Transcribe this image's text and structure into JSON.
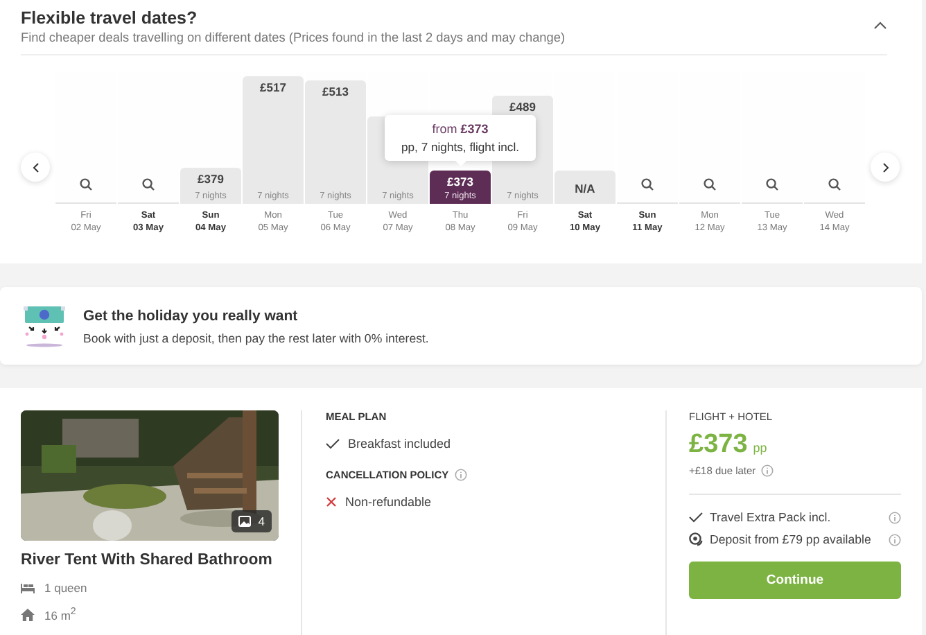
{
  "flexible_dates": {
    "title": "Flexible travel dates?",
    "subtitle": "Find cheaper deals travelling on different dates (Prices found in the last 2 days and may change)",
    "expanded": true,
    "tooltip": {
      "line_1": "from **£373**",
      "line_2": "pp, 7 nights, flight incl."
    },
    "days": [
      {
        "kind": "search",
        "weekday": "Fri",
        "date": "02 May",
        "highlighted": false,
        "selected": false
      },
      {
        "kind": "search",
        "weekday": "Sat",
        "date": "03 May",
        "highlighted": true,
        "selected": false
      },
      {
        "kind": "price",
        "price": "£379",
        "nights": "7 nights",
        "level": 0.27,
        "weekday": "Sun",
        "date": "04 May",
        "highlighted": true,
        "selected": false
      },
      {
        "kind": "price",
        "price": "£517",
        "nights": "7 nights",
        "level": 0.97,
        "weekday": "Mon",
        "date": "05 May",
        "highlighted": false,
        "selected": false
      },
      {
        "kind": "price",
        "price": "£513",
        "nights": "7 nights",
        "level": 0.94,
        "weekday": "Tue",
        "date": "06 May",
        "highlighted": false,
        "selected": false
      },
      {
        "kind": "price",
        "nights": "7 nights",
        "level": 0.66,
        "weekday": "Wed",
        "date": "07 May",
        "highlighted": false,
        "selected": false
      },
      {
        "kind": "price",
        "price": "£373",
        "nights": "7 nights",
        "level": 0.25,
        "weekday": "Thu",
        "date": "08 May",
        "highlighted": false,
        "selected": true
      },
      {
        "kind": "price",
        "price": "£489",
        "nights": "7 nights",
        "level": 0.82,
        "weekday": "Fri",
        "date": "09 May",
        "highlighted": false,
        "selected": false
      },
      {
        "kind": "na",
        "price": "N/A",
        "level": 0.25,
        "weekday": "Sat",
        "date": "10 May",
        "highlighted": true,
        "selected": false
      },
      {
        "kind": "search",
        "weekday": "Sun",
        "date": "11 May",
        "highlighted": true,
        "selected": false
      },
      {
        "kind": "search",
        "weekday": "Mon",
        "date": "12 May",
        "highlighted": false,
        "selected": false
      },
      {
        "kind": "search",
        "weekday": "Tue",
        "date": "13 May",
        "highlighted": false,
        "selected": false
      },
      {
        "kind": "search",
        "weekday": "Wed",
        "date": "14 May",
        "highlighted": false,
        "selected": false
      }
    ]
  },
  "promo": {
    "title": "Get the holiday you really want",
    "text": "Book with just a deposit, then pay the rest later with 0% interest."
  },
  "room": {
    "photo": {
      "kind": "picture",
      "count": "4"
    },
    "name": "River Tent With Shared Bathroom",
    "features": [
      {
        "kind": "bed",
        "text": "1 queen"
      },
      {
        "kind": "size",
        "text": "16 m$^{2}$"
      }
    ],
    "meal_plan": {
      "heading": "MEAL PLAN",
      "value": "Breakfast included",
      "included": true
    },
    "cancellation": {
      "heading": "CANCELLATION POLICY",
      "value": "Non-refundable",
      "included": false
    },
    "package": {
      "label": "FLIGHT + HOTEL",
      "price": "£373",
      "unit": "pp",
      "due_later": "+£18 due later",
      "perks": [
        {
          "kind": "check",
          "text": "Travel Extra Pack incl."
        },
        {
          "kind": "deposit",
          "text": "Deposit from £79 pp available"
        }
      ],
      "button": "Continue"
    }
  }
}
